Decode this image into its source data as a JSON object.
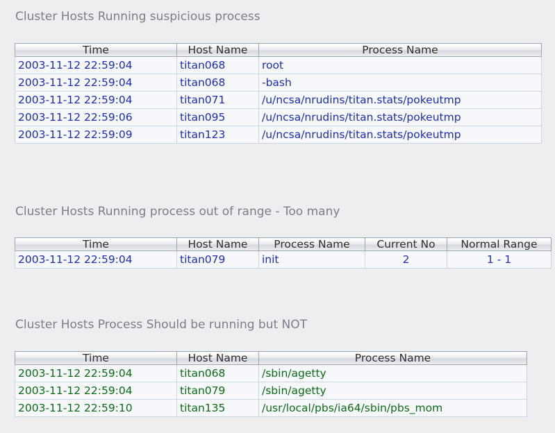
{
  "sections": [
    {
      "title": "Cluster Hosts Running suspicious process",
      "headers": [
        "Time",
        "Host Name",
        "Process Name"
      ],
      "rows": [
        [
          "2003-11-12 22:59:04",
          "titan068",
          "root"
        ],
        [
          "2003-11-12 22:59:04",
          "titan068",
          "-bash"
        ],
        [
          "2003-11-12 22:59:04",
          "titan071",
          "/u/ncsa/nrudins/titan.stats/pokeutmp"
        ],
        [
          "2003-11-12 22:59:06",
          "titan095",
          "/u/ncsa/nrudins/titan.stats/pokeutmp"
        ],
        [
          "2003-11-12 22:59:09",
          "titan123",
          "/u/ncsa/nrudins/titan.stats/pokeutmp"
        ]
      ]
    },
    {
      "title": "Cluster Hosts Running process out of range - Too many",
      "headers": [
        "Time",
        "Host Name",
        "Process Name",
        "Current No",
        "Normal Range"
      ],
      "rows": [
        [
          "2003-11-12 22:59:04",
          "titan079",
          "init",
          "2",
          "1 - 1"
        ]
      ]
    },
    {
      "title": "Cluster Hosts Process Should be running but NOT",
      "headers": [
        "Time",
        "Host Name",
        "Process Name"
      ],
      "rows": [
        [
          "2003-11-12 22:59:04",
          "titan068",
          "/sbin/agetty"
        ],
        [
          "2003-11-12 22:59:04",
          "titan079",
          "/sbin/agetty"
        ],
        [
          "2003-11-12 22:59:10",
          "titan135",
          "/usr/local/pbs/ia64/sbin/pbs_mom"
        ]
      ]
    }
  ],
  "colors": {
    "background": "#eceef0",
    "title_text": "#7b7f84",
    "blue_rows": "#1b2eb0",
    "green_rows": "#0a6d12"
  }
}
